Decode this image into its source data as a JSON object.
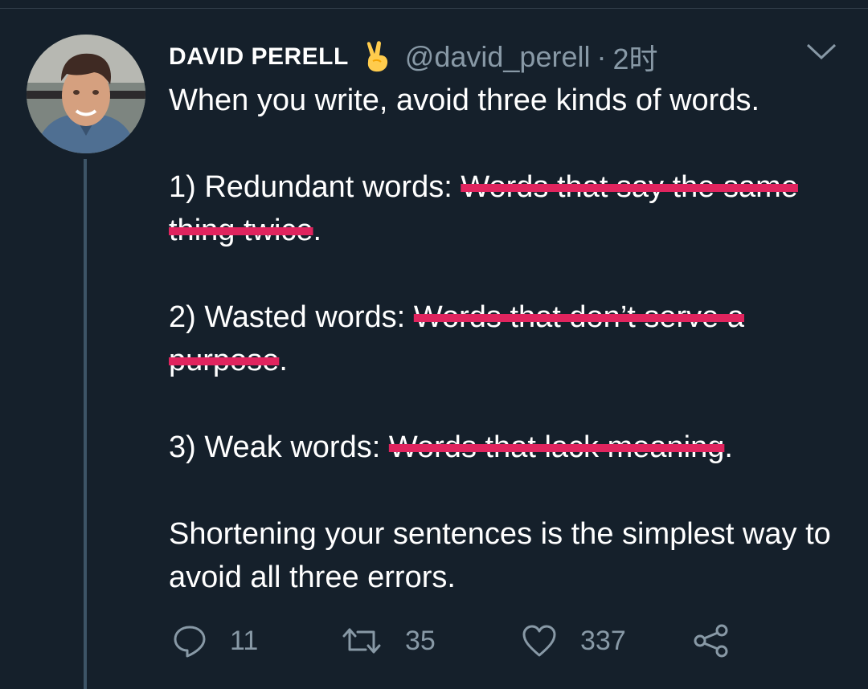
{
  "tweet": {
    "author": {
      "name": "DAVID PERELL",
      "emoji": "victory-hand-emoji",
      "handle": "@david_perell",
      "separator": "·",
      "time": "2时"
    },
    "body": {
      "intro": "When you write, avoid three kinds of words.",
      "item1_prefix": "1) Redundant words: ",
      "item1_struck": "Words that say the same thing twice",
      "item1_suffix": ".",
      "item2_prefix": "2) Wasted words: ",
      "item2_struck": "Words that don’t serve a purpose",
      "item2_suffix": ".",
      "item3_prefix": "3) Weak words: ",
      "item3_struck": "Words that lack meaning",
      "item3_suffix": ".",
      "conclusion": "Shortening your sentences is the simplest way to avoid all three errors."
    },
    "actions": {
      "reply_count": "11",
      "retweet_count": "35",
      "like_count": "337"
    },
    "colors": {
      "background": "#15202b",
      "text": "#ffffff",
      "secondary": "#8899a6",
      "strike": "#e0245e",
      "thread_line": "#3d5466"
    }
  }
}
